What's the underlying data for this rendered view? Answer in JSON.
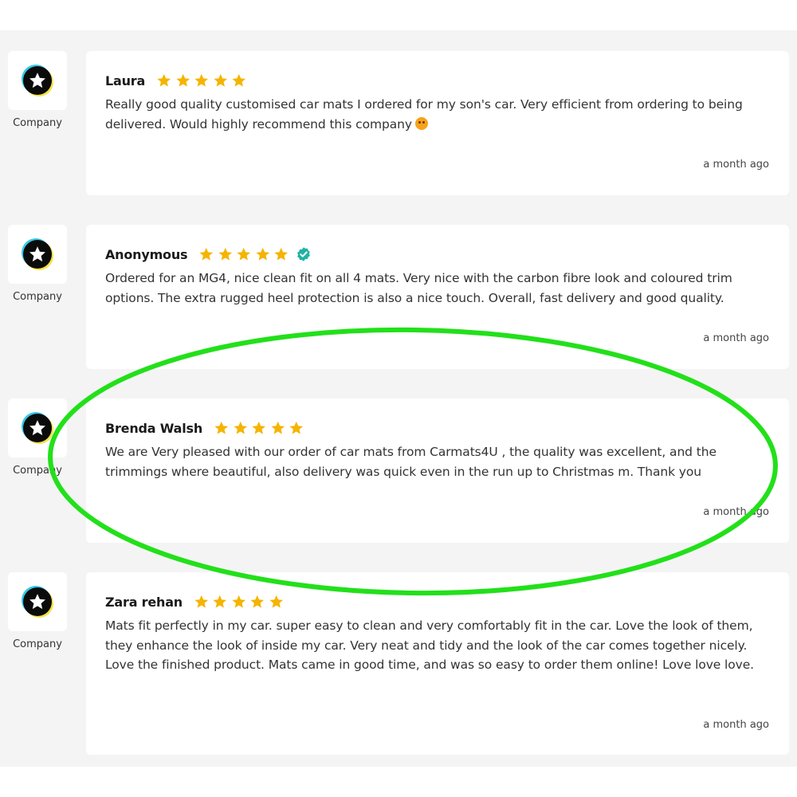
{
  "colors": {
    "background": "#f4f4f4",
    "card": "#ffffff",
    "star": "#f5b400",
    "verified": "#1fb2a6",
    "highlight": "#22e01a"
  },
  "icons": {
    "logo": "star-logo-icon",
    "rating": "star-icon",
    "verified": "verified-check-icon"
  },
  "reviews": [
    {
      "company_label": "Company",
      "name": "Laura",
      "rating": 5,
      "verified": false,
      "text": "Really good quality customised car mats I ordered for my son's car. Very efficient from ordering to being delivered. Would highly recommend this company",
      "emoji": "smiling-face-emoji",
      "time": "a month ago"
    },
    {
      "company_label": "Company",
      "name": "Anonymous",
      "rating": 5,
      "verified": true,
      "text": "Ordered for an MG4, nice clean fit on all 4 mats. Very nice with the carbon fibre look and coloured trim options. The extra rugged heel protection is also a nice touch. Overall, fast delivery and good quality.",
      "time": "a month ago"
    },
    {
      "company_label": "Company",
      "name": "Brenda Walsh",
      "rating": 5,
      "verified": false,
      "text": "We are Very pleased with our order of car mats from Carmats4U , the quality  was excellent, and the trimmings where beautiful, also delivery was quick even in the run up to Christmas m. Thank you",
      "time": "a month ago",
      "highlighted": true
    },
    {
      "company_label": "Company",
      "name": "Zara rehan",
      "rating": 5,
      "verified": false,
      "text": "Mats fit perfectly in my car. super easy to clean and very comfortably fit in the car. Love the look of them, they enhance the look of inside my car. Very neat and tidy and the look of the car comes together nicely. Love the finished product. Mats came in good time, and was so easy to order them online! Love love love.",
      "time": "a month ago"
    }
  ]
}
